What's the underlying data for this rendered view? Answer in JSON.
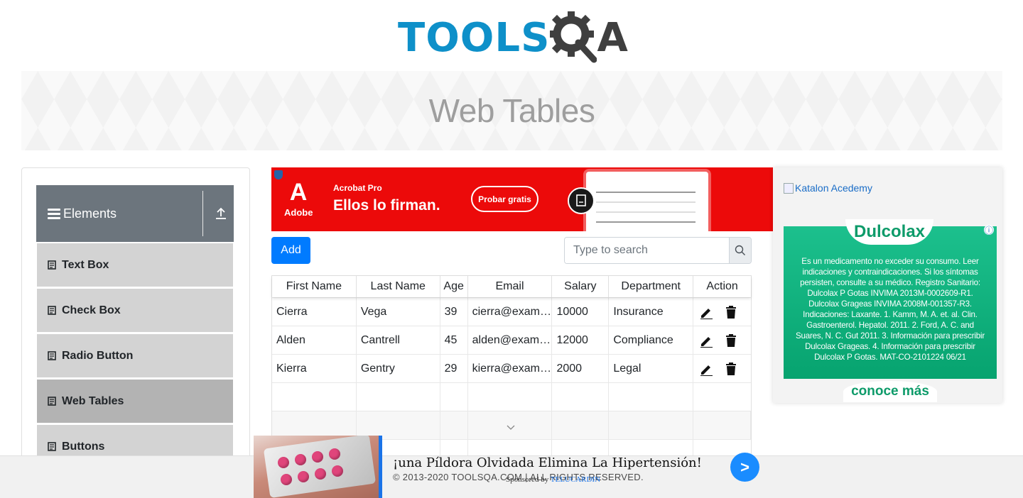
{
  "header": {
    "logo_text_left": "TOOLS",
    "logo_text_right": "A"
  },
  "banner": {
    "title": "Web Tables"
  },
  "sidebar": {
    "group_title": "Elements",
    "items": [
      {
        "label": "Text Box"
      },
      {
        "label": "Check Box"
      },
      {
        "label": "Radio Button"
      },
      {
        "label": "Web Tables",
        "active": true
      },
      {
        "label": "Buttons"
      }
    ]
  },
  "ad_top": {
    "brand": "Adobe",
    "product": "Acrobat Pro",
    "headline": "Ellos lo firman.",
    "cta": "Probar gratis"
  },
  "toolbar": {
    "add_label": "Add",
    "search_placeholder": "Type to search"
  },
  "table": {
    "headers": [
      "First Name",
      "Last Name",
      "Age",
      "Email",
      "Salary",
      "Department",
      "Action"
    ],
    "rows": [
      {
        "first": "Cierra",
        "last": "Vega",
        "age": "39",
        "email": "cierra@example.com",
        "salary": "10000",
        "dept": "Insurance"
      },
      {
        "first": "Alden",
        "last": "Cantrell",
        "age": "45",
        "email": "alden@example.com",
        "salary": "12000",
        "dept": "Compliance"
      },
      {
        "first": "Kierra",
        "last": "Gentry",
        "age": "29",
        "email": "kierra@example.com",
        "salary": "2000",
        "dept": "Legal"
      }
    ]
  },
  "right_ad": {
    "katalon_alt": "Katalon Acedemy",
    "dulco_brand": "Dulcolax",
    "dulco_info": "ⓘ",
    "dulco_text": "Es un medicamento no exceder su consumo. Leer indicaciones y contraindicaciones. Si los síntomas persisten, consulte a su médico. Registro Sanitario: Dulcolax P Gotas INVIMA 2013M-0002609-R1. Dulcolax Grageas INVIMA 2008M-001357-R3. Indicaciones: Laxante. 1. Kamm, M. A. et. al. Clin. Gastroenterol. Hepatol. 2011. 2. Ford, A. C. and Suares, N. C. Gut 2011. 3. Información para prescribir Dulcolax Grageas. 4. Información para prescribir Dulcolax P Gotas. MAT-CO-2101224 06/21",
    "dulco_cta": "conoce más"
  },
  "footer": {
    "copyright": "© 2013-2020 TOOLSQA.COM | ALL RIGHTS RESERVED."
  },
  "sticky_ad": {
    "headline": "¡una Píldora Olvidada Elimina La Hipertensión!",
    "sponsor_prefix": "Sponsored by",
    "sponsor_name": "TELUCARDIN",
    "go": ">"
  },
  "colors": {
    "brand_blue": "#0e90c9",
    "primary": "#007bff",
    "sidebar_header": "#6c757d",
    "menu_bg": "#d3d3d3",
    "menu_active": "#b3b3b3"
  }
}
